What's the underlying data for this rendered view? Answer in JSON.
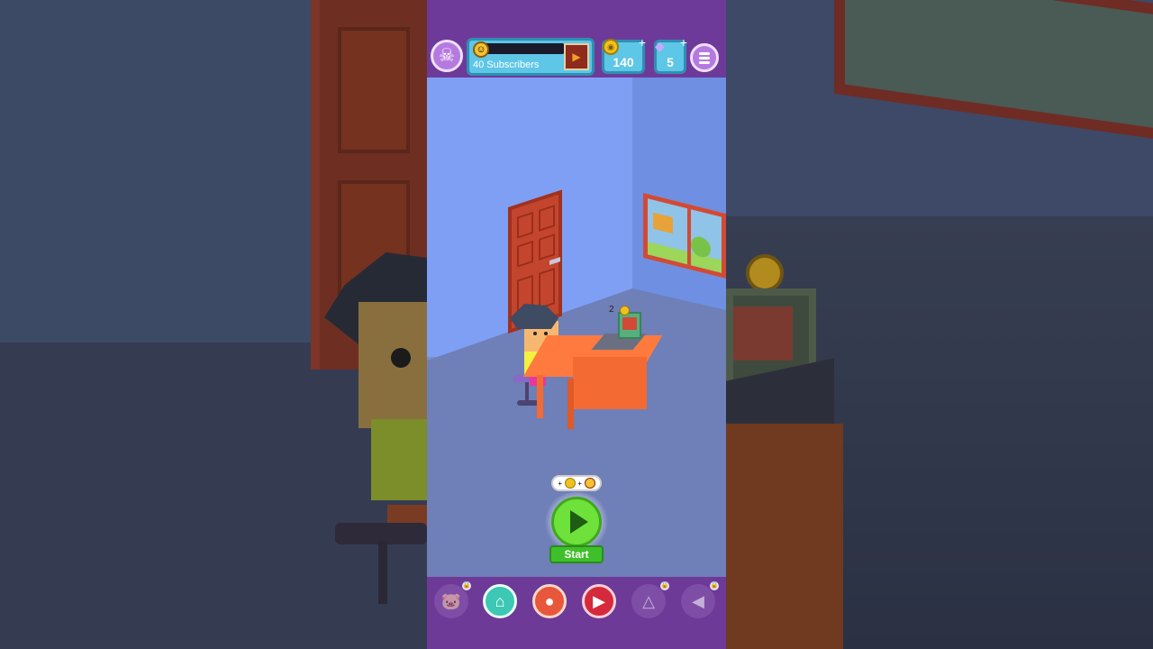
{
  "hud": {
    "subscribers_label": "40 Subscribers",
    "coins": "140",
    "gems": "5",
    "plus_symbol": "+",
    "menu_icon": "hamburger-menu-icon",
    "profile_icon": "skull-icon"
  },
  "room": {
    "laptop_reward": "2"
  },
  "start": {
    "label": "Start",
    "reward_icons": [
      "view-coin-icon",
      "subscriber-face-icon"
    ],
    "plus": "+"
  },
  "bottom_nav": [
    {
      "name": "pet",
      "icon": "pig-icon",
      "locked": true,
      "color": "#8a5ab0"
    },
    {
      "name": "shop",
      "icon": "shop-bag-icon",
      "locked": false,
      "color": "#3cc8b4"
    },
    {
      "name": "record",
      "icon": "video-camera-icon",
      "locked": false,
      "color": "#e8563c"
    },
    {
      "name": "videos",
      "icon": "play-screen-icon",
      "locked": false,
      "color": "#d42a3c"
    },
    {
      "name": "wardrobe",
      "icon": "hanger-icon",
      "locked": true,
      "color": "#8a5ab0"
    },
    {
      "name": "promote",
      "icon": "megaphone-icon",
      "locked": true,
      "color": "#8a5ab0"
    }
  ],
  "colors": {
    "top_bar": "#6e3a9a",
    "hud_panel": "#5ec6e6",
    "play_button": "#6ee23a",
    "room_wall": "#7f9ff4"
  }
}
